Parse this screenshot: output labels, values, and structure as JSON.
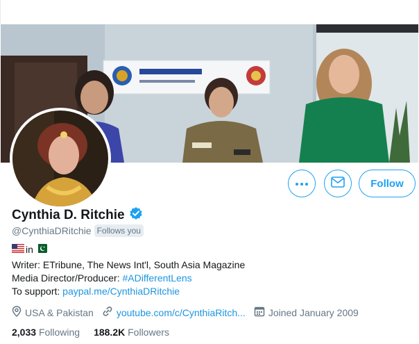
{
  "profile": {
    "name": "Cynthia D. Ritchie",
    "handle": "@CynthiaDRitchie",
    "follows_you": "Follows you",
    "flags_text": "in",
    "bio_line1": "Writer: ETribune, The News Int'l, South Asia Magazine",
    "bio_line2_prefix": "Media Director/Producer: ",
    "bio_hashtag": "#ADifferentLens",
    "bio_line3_prefix": "To support: ",
    "bio_paypal": "paypal.me/CynthiaDRitchie",
    "location": "USA & Pakistan",
    "website": "youtube.com/c/CynthiaRitch...",
    "joined": "Joined January 2009",
    "following_count": "2,033",
    "following_label": "Following",
    "followers_count": "188.2K",
    "followers_label": "Followers"
  },
  "actions": {
    "follow_label": "Follow",
    "more_icon": "more-icon",
    "message_icon": "envelope-icon"
  },
  "colors": {
    "accent": "#1da1f2",
    "link": "#1b95e0",
    "secondary_text": "#657786",
    "verified": "#1da1f2"
  }
}
